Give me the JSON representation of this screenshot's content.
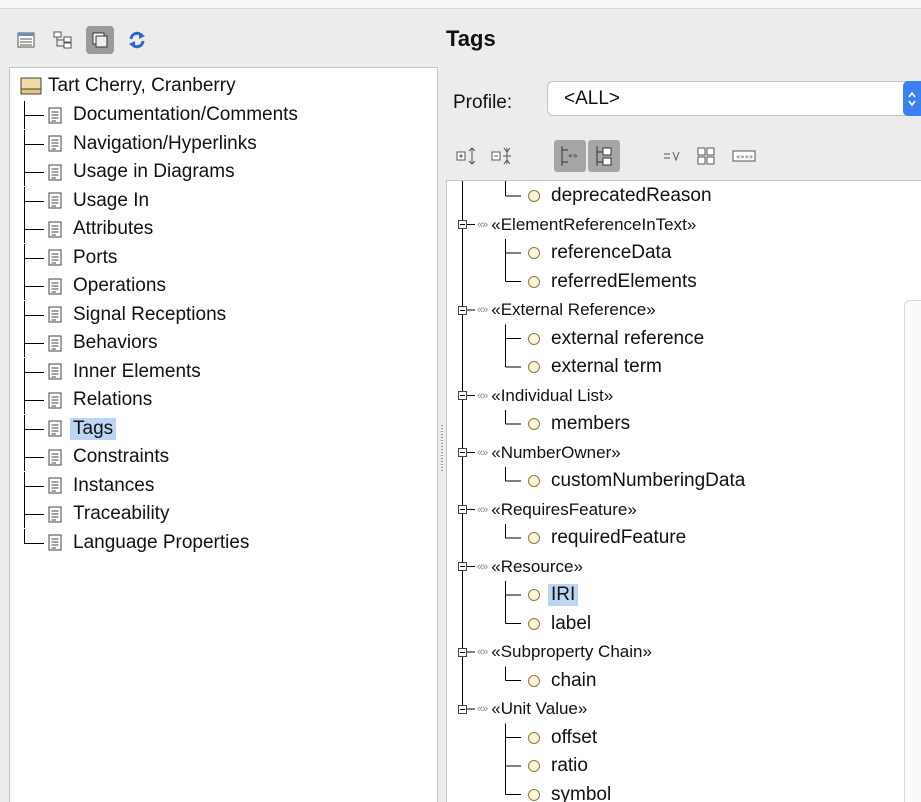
{
  "toolbar": {
    "icons": [
      "table-view-icon",
      "tree-view-icon",
      "window-toggle-icon",
      "refresh-icon"
    ]
  },
  "left_panel": {
    "root": "Tart Cherry, Cranberry",
    "items": [
      "Documentation/Comments",
      "Navigation/Hyperlinks",
      "Usage in Diagrams",
      "Usage In",
      "Attributes",
      "Ports",
      "Operations",
      "Signal Receptions",
      "Behaviors",
      "Inner Elements",
      "Relations",
      "Tags",
      "Constraints",
      "Instances",
      "Traceability",
      "Language Properties"
    ],
    "selected": "Tags"
  },
  "right_panel": {
    "title": "Tags",
    "profile_label": "Profile:",
    "profile_value": "<ALL>",
    "tree": [
      {
        "kind": "prop",
        "label": "deprecatedReason"
      },
      {
        "kind": "stereo",
        "label": "«ElementReferenceInText»"
      },
      {
        "kind": "prop",
        "label": "referenceData"
      },
      {
        "kind": "prop",
        "label": "referredElements"
      },
      {
        "kind": "stereo",
        "label": "«External Reference»"
      },
      {
        "kind": "prop",
        "label": "external reference"
      },
      {
        "kind": "prop",
        "label": "external term"
      },
      {
        "kind": "stereo",
        "label": "«Individual List»"
      },
      {
        "kind": "prop",
        "label": "members"
      },
      {
        "kind": "stereo",
        "label": "«NumberOwner»"
      },
      {
        "kind": "prop",
        "label": "customNumberingData"
      },
      {
        "kind": "stereo",
        "label": "«RequiresFeature»"
      },
      {
        "kind": "prop",
        "label": "requiredFeature"
      },
      {
        "kind": "stereo",
        "label": "«Resource»"
      },
      {
        "kind": "prop",
        "label": "IRI",
        "selected": true
      },
      {
        "kind": "prop",
        "label": "label"
      },
      {
        "kind": "stereo",
        "label": "«Subproperty Chain»"
      },
      {
        "kind": "prop",
        "label": "chain"
      },
      {
        "kind": "stereo",
        "label": "«Unit Value»"
      },
      {
        "kind": "prop",
        "label": "offset"
      },
      {
        "kind": "prop",
        "label": "ratio"
      },
      {
        "kind": "prop",
        "label": "symbol"
      }
    ],
    "toolbar_icons": [
      "expand-all-icon",
      "collapse-all-icon",
      "show-stereotypes-icon",
      "show-tree-icon",
      "equals-value-icon",
      "grid-view-icon",
      "stereotype-filter-icon"
    ]
  },
  "colors": {
    "selection": "#bcd5f3",
    "select_arrow": "#3c7ff0",
    "refresh_icon": "#2a64d8"
  }
}
